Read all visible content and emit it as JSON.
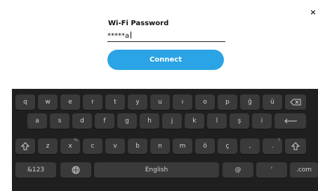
{
  "dialog": {
    "close_icon": "×",
    "title": "Wi-Fi Password",
    "password_value": "*****a",
    "connect_label": "Connect"
  },
  "keyboard": {
    "row1": [
      "q",
      "w",
      "e",
      "r",
      "t",
      "y",
      "u",
      "ı",
      "o",
      "p",
      "ğ",
      "ü"
    ],
    "row2": [
      "a",
      "s",
      "d",
      "f",
      "g",
      "h",
      "j",
      "k",
      "l",
      "ş",
      "i"
    ],
    "row3": [
      "z",
      "x",
      "c",
      "v",
      "b",
      "n",
      "m",
      "ö",
      "ç",
      ",",
      "."
    ],
    "row3_hints": {
      "x": "%",
      ".": "?"
    },
    "numbers_label": "&123",
    "space_label": "English",
    "at_label": "@",
    "apostrophe_label": "'",
    "com_label": ".com",
    "icons": {
      "backspace": "backspace-icon",
      "enter": "enter-icon",
      "shift": "shift-icon",
      "language": "globe-icon"
    }
  }
}
